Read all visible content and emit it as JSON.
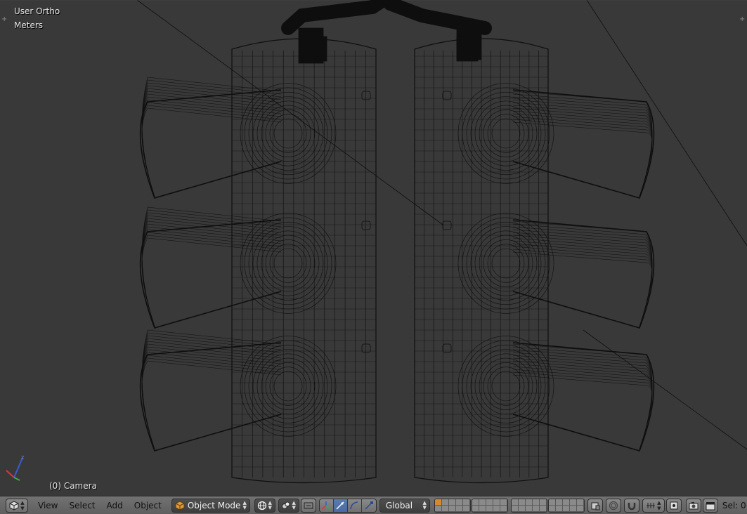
{
  "viewport": {
    "view_label": "User Ortho",
    "units_label": "Meters",
    "object_label": "(0) Camera",
    "axes": {
      "x_color": "#d43a3a",
      "y_color": "#3bb03b",
      "z_color": "#3a5ad4",
      "z_letter": "z"
    }
  },
  "header": {
    "editor_icon": "cube-icon",
    "menus": [
      "View",
      "Select",
      "Add",
      "Object"
    ],
    "mode": {
      "label": "Object Mode",
      "icon": "cube-orange-icon"
    },
    "pivot_icon": "globe-icon",
    "transform_orientation": "Global",
    "selection_count": "Sel: 0",
    "accent_color": "#5a7cb0"
  }
}
